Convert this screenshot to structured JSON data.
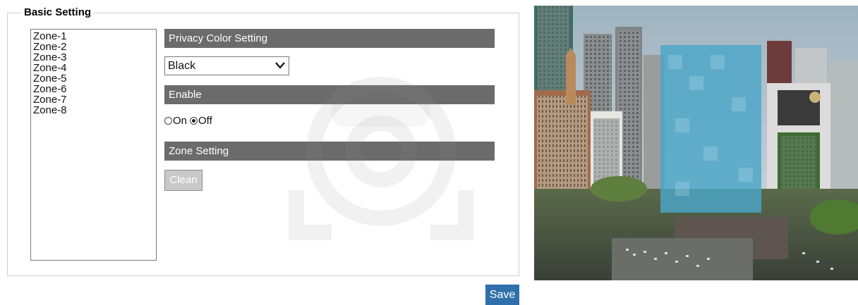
{
  "section": {
    "legend": "Basic Setting"
  },
  "zones": [
    "Zone-1",
    "Zone-2",
    "Zone-3",
    "Zone-4",
    "Zone-5",
    "Zone-6",
    "Zone-7",
    "Zone-8"
  ],
  "privacy_color": {
    "header": "Privacy Color Setting",
    "selected": "Black"
  },
  "enable": {
    "header": "Enable",
    "options": [
      "On",
      "Off"
    ],
    "selected": "Off"
  },
  "zone_setting": {
    "header": "Zone Setting",
    "clean_label": "Clean"
  },
  "actions": {
    "save_label": "Save"
  },
  "colors": {
    "header_bar": "#6b6b6b",
    "save_button": "#2f6fab",
    "privacy_mask": "#4aa6c8"
  },
  "icons": {
    "select_arrow": "chevron-down-icon"
  }
}
